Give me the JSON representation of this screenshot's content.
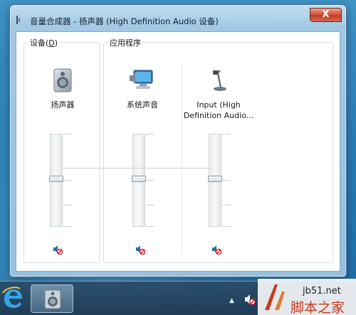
{
  "window": {
    "title": "音量合成器 - 扬声器 (High Definition Audio 设备)",
    "close_label": "X"
  },
  "devices_group": {
    "label_prefix": "设备(",
    "label_accel": "D",
    "label_suffix": ")",
    "channels": [
      {
        "label": "扬声器",
        "icon": "speaker-icon",
        "volume_fraction": 0.56,
        "muted": true
      }
    ]
  },
  "apps_group": {
    "label": "应用程序",
    "channels": [
      {
        "label": "系统声音",
        "icon": "system-sounds-icon",
        "volume_fraction": 0.56,
        "muted": true
      },
      {
        "label_line1": "Input (High",
        "label_line2": "Definition Audio...",
        "icon": "microphone-icon",
        "volume_fraction": 0.56,
        "muted": true
      }
    ]
  },
  "taskbar": {
    "items": [
      "internet-explorer-icon",
      "volume-mixer-app-icon"
    ],
    "tray": [
      "show-hidden-icons-arrow",
      "volume-muted-icon"
    ]
  },
  "watermark": {
    "url": "jb51.net",
    "text": "脚本之家"
  },
  "colors": {
    "desktop": "#2c7fb6",
    "close_button": "#c43b23",
    "watermark_red": "#c43a1c"
  }
}
